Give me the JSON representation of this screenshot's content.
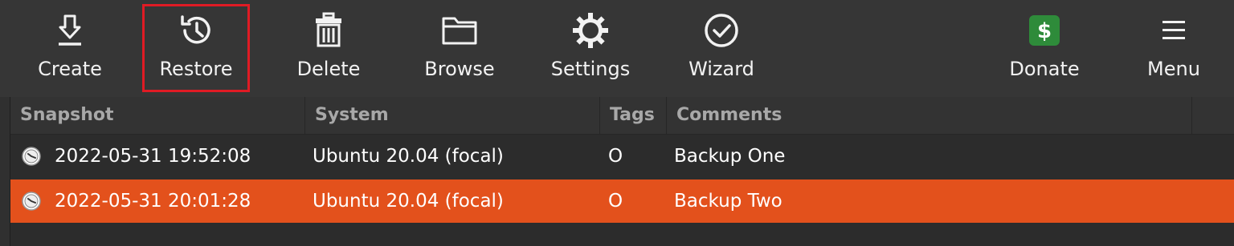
{
  "toolbar": {
    "items": [
      {
        "label": "Create",
        "icon": "download-arrow-icon"
      },
      {
        "label": "Restore",
        "icon": "history-clock-icon"
      },
      {
        "label": "Delete",
        "icon": "trash-icon"
      },
      {
        "label": "Browse",
        "icon": "folder-icon"
      },
      {
        "label": "Settings",
        "icon": "gear-icon"
      },
      {
        "label": "Wizard",
        "icon": "check-circle-icon"
      },
      {
        "label": "Donate",
        "icon": "dollar-icon"
      },
      {
        "label": "Menu",
        "icon": "hamburger-menu-icon"
      }
    ],
    "selected": "Restore"
  },
  "table": {
    "columns": [
      "Snapshot",
      "System",
      "Tags",
      "Comments"
    ],
    "rows": [
      {
        "snapshot": "2022-05-31 19:52:08",
        "system": "Ubuntu 20.04 (focal)",
        "tags": "O",
        "comments": "Backup One",
        "selected": false
      },
      {
        "snapshot": "2022-05-31 20:01:28",
        "system": "Ubuntu 20.04 (focal)",
        "tags": "O",
        "comments": "Backup Two",
        "selected": true
      }
    ]
  },
  "colors": {
    "selection": "#e3511c",
    "highlight_box": "#e01b24",
    "donate_green": "#2e8b3a"
  }
}
